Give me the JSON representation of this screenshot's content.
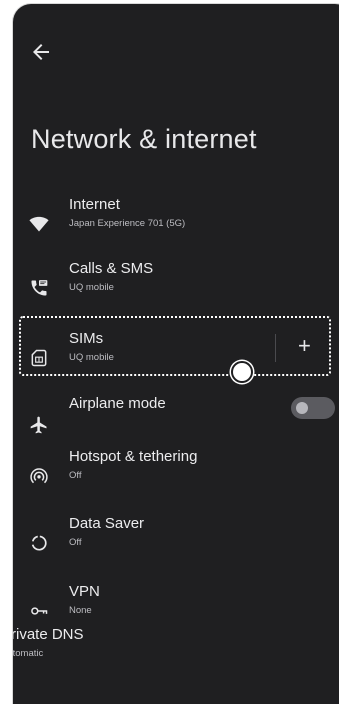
{
  "header": {
    "back_icon": "arrow-back-icon",
    "title": "Network & internet"
  },
  "items": [
    {
      "icon": "wifi-icon",
      "title": "Internet",
      "subtitle": "Japan Experience 701 (5G)"
    },
    {
      "icon": "calls-sms-icon",
      "title": "Calls & SMS",
      "subtitle": "UQ mobile"
    },
    {
      "icon": "sim-card-icon",
      "title": "SIMs",
      "subtitle": "UQ mobile",
      "action": "+"
    },
    {
      "icon": "airplane-icon",
      "title": "Airplane mode",
      "toggle_on": false
    },
    {
      "icon": "hotspot-icon",
      "title": "Hotspot & tethering",
      "subtitle": "Off"
    },
    {
      "icon": "data-saver-icon",
      "title": "Data Saver",
      "subtitle": "Off"
    },
    {
      "icon": "vpn-key-icon",
      "title": "VPN",
      "subtitle": "None"
    },
    {
      "title": "Private DNS",
      "subtitle": "Automatic"
    }
  ],
  "colors": {
    "background": "#1f1f21",
    "text_primary": "#ececee",
    "text_secondary": "#bdbdc2",
    "toggle_off": "#5b5b60"
  }
}
